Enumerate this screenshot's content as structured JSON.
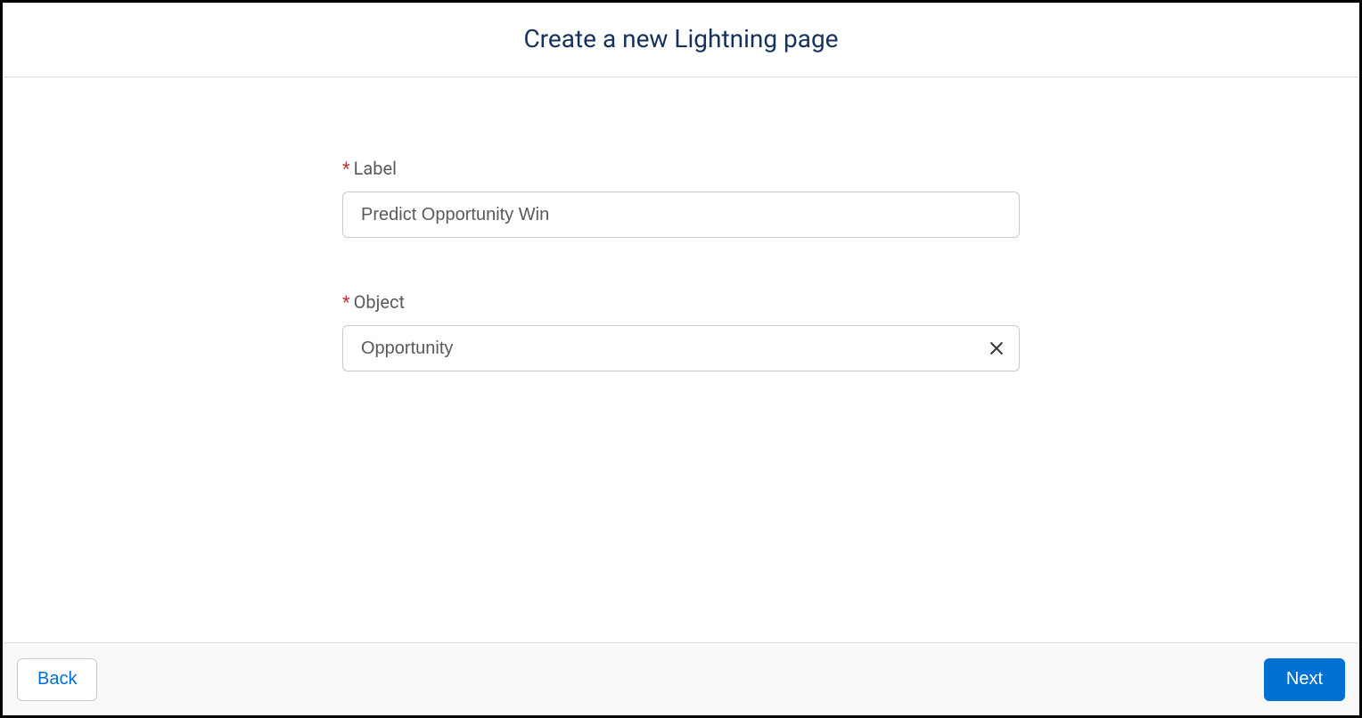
{
  "header": {
    "title": "Create a new Lightning page"
  },
  "form": {
    "label": {
      "label": "Label",
      "value": "Predict Opportunity Win",
      "required_marker": "*"
    },
    "object": {
      "label": "Object",
      "value": "Opportunity",
      "required_marker": "*"
    }
  },
  "footer": {
    "back_label": "Back",
    "next_label": "Next"
  }
}
